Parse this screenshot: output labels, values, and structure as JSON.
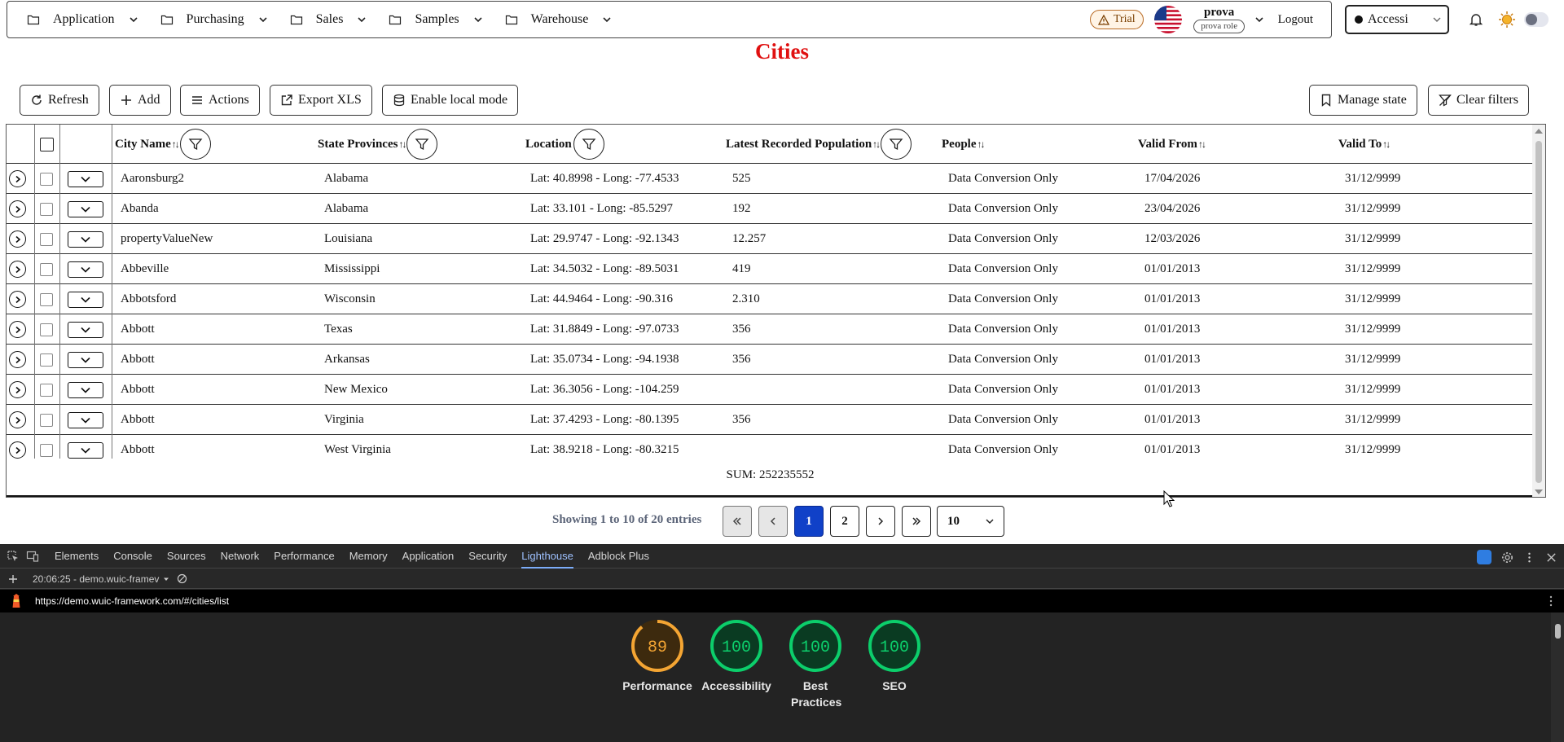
{
  "nav": {
    "menus": [
      "Application",
      "Purchasing",
      "Sales",
      "Samples",
      "Warehouse"
    ],
    "trial_label": "Trial",
    "user_name": "prova",
    "user_role": "prova role",
    "logout_label": "Logout",
    "accessibility_label": "Accessi"
  },
  "page": {
    "title": "Cities"
  },
  "toolbar": {
    "refresh": "Refresh",
    "add": "Add",
    "actions": "Actions",
    "export": "Export XLS",
    "local_mode": "Enable local mode",
    "manage_state": "Manage state",
    "clear_filters": "Clear filters"
  },
  "grid": {
    "columns": [
      "City Name",
      "State Provinces",
      "Location",
      "Latest Recorded Population",
      "People",
      "Valid From",
      "Valid To"
    ],
    "rows": [
      {
        "city": "Aaronsburg2",
        "state": "Alabama",
        "location": "Lat: 40.8998 - Long: -77.4533",
        "population": "525",
        "people": "Data Conversion Only",
        "valid_from": "17/04/2026",
        "valid_to": "31/12/9999"
      },
      {
        "city": "Abanda",
        "state": "Alabama",
        "location": "Lat: 33.101 - Long: -85.5297",
        "population": "192",
        "people": "Data Conversion Only",
        "valid_from": "23/04/2026",
        "valid_to": "31/12/9999"
      },
      {
        "city": "propertyValueNew",
        "state": "Louisiana",
        "location": "Lat: 29.9747 - Long: -92.1343",
        "population": "12.257",
        "people": "Data Conversion Only",
        "valid_from": "12/03/2026",
        "valid_to": "31/12/9999"
      },
      {
        "city": "Abbeville",
        "state": "Mississippi",
        "location": "Lat: 34.5032 - Long: -89.5031",
        "population": "419",
        "people": "Data Conversion Only",
        "valid_from": "01/01/2013",
        "valid_to": "31/12/9999"
      },
      {
        "city": "Abbotsford",
        "state": "Wisconsin",
        "location": "Lat: 44.9464 - Long: -90.316",
        "population": "2.310",
        "people": "Data Conversion Only",
        "valid_from": "01/01/2013",
        "valid_to": "31/12/9999"
      },
      {
        "city": "Abbott",
        "state": "Texas",
        "location": "Lat: 31.8849 - Long: -97.0733",
        "population": "356",
        "people": "Data Conversion Only",
        "valid_from": "01/01/2013",
        "valid_to": "31/12/9999"
      },
      {
        "city": "Abbott",
        "state": "Arkansas",
        "location": "Lat: 35.0734 - Long: -94.1938",
        "population": "356",
        "people": "Data Conversion Only",
        "valid_from": "01/01/2013",
        "valid_to": "31/12/9999"
      },
      {
        "city": "Abbott",
        "state": "New Mexico",
        "location": "Lat: 36.3056 - Long: -104.259",
        "population": "",
        "people": "Data Conversion Only",
        "valid_from": "01/01/2013",
        "valid_to": "31/12/9999"
      },
      {
        "city": "Abbott",
        "state": "Virginia",
        "location": "Lat: 37.4293 - Long: -80.1395",
        "population": "356",
        "people": "Data Conversion Only",
        "valid_from": "01/01/2013",
        "valid_to": "31/12/9999"
      },
      {
        "city": "Abbott",
        "state": "West Virginia",
        "location": "Lat: 38.9218 - Long: -80.3215",
        "population": "",
        "people": "Data Conversion Only",
        "valid_from": "01/01/2013",
        "valid_to": "31/12/9999"
      }
    ],
    "sum_label": "SUM: 252235552"
  },
  "pager": {
    "info": "Showing 1 to 10 of 20 entries",
    "pages": [
      "1",
      "2"
    ],
    "current_page": "1",
    "page_size": "10"
  },
  "devtools": {
    "tabs": [
      "Elements",
      "Console",
      "Sources",
      "Network",
      "Performance",
      "Memory",
      "Application",
      "Security",
      "Lighthouse",
      "Adblock Plus"
    ],
    "selected_tab": "Lighthouse",
    "report_label": "20:06:25 - demo.wuic-framev",
    "url": "https://demo.wuic-framework.com/#/cities/list",
    "scores": [
      {
        "label": "Performance",
        "value": "89",
        "color": "#f4a533"
      },
      {
        "label": "Accessibility",
        "value": "100",
        "color": "#0cce6b"
      },
      {
        "label": "Best Practices",
        "value": "100",
        "color": "#0cce6b"
      },
      {
        "label": "SEO",
        "value": "100",
        "color": "#0cce6b"
      }
    ]
  }
}
